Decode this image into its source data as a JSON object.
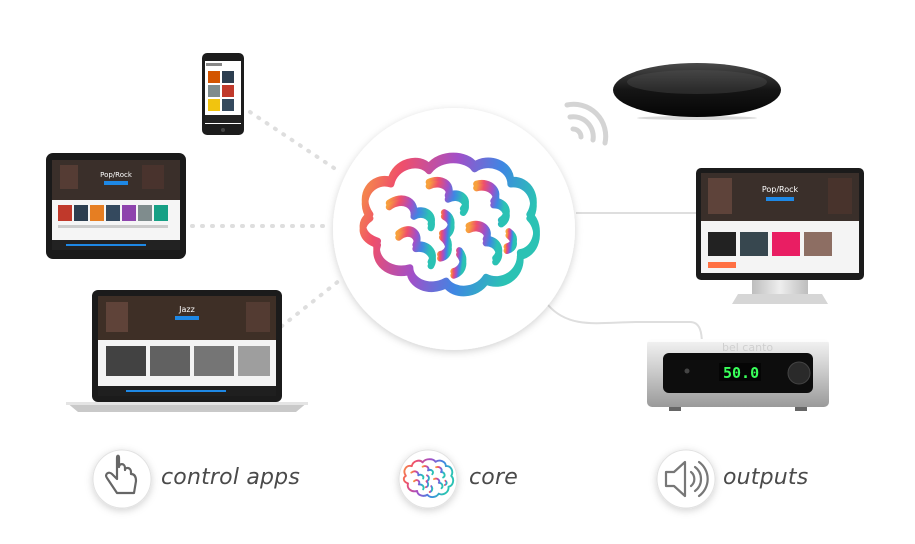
{
  "legend": {
    "control_label": "control apps",
    "core_label": "core",
    "outputs_label": "outputs"
  },
  "devices": {
    "phone": {
      "icon": "smartphone-icon"
    },
    "tablet": {
      "icon": "tablet-icon",
      "screen_title": "Pop/Rock"
    },
    "laptop": {
      "icon": "laptop-icon",
      "screen_title": "Jazz"
    },
    "speaker": {
      "icon": "wireless-speaker-icon"
    },
    "monitor": {
      "icon": "monitor-icon",
      "screen_title": "Pop/Rock"
    },
    "amplifier": {
      "icon": "amplifier-icon",
      "brand": "bel canto",
      "display": "50.0"
    }
  },
  "core": {
    "icon": "brain-icon"
  },
  "icons": {
    "control": "hand-pointer-icon",
    "core": "brain-icon",
    "outputs": "speaker-sound-icon"
  },
  "colors": {
    "line": "#dedede",
    "label": "#4a4a4a",
    "display": "#39ff5a",
    "brain": [
      "#f7a13c",
      "#ef4f6b",
      "#a24fc8",
      "#3f86e3",
      "#2bc2b4"
    ]
  }
}
